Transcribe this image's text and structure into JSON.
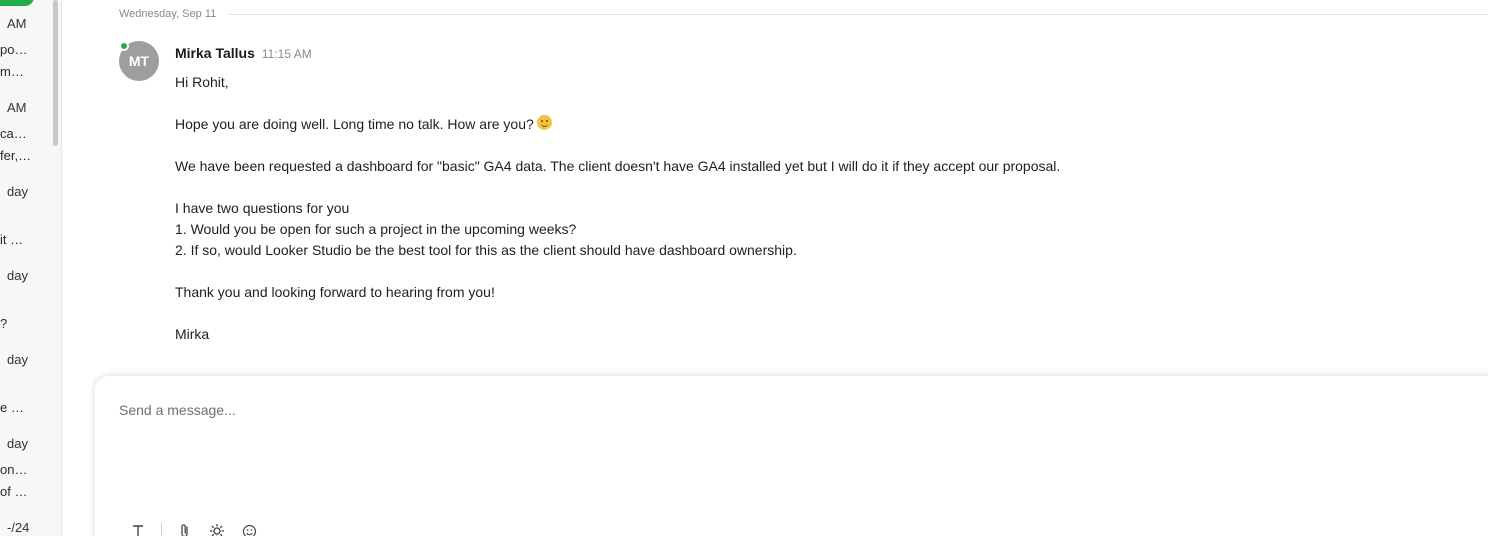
{
  "sidebar": {
    "items": [
      {
        "text": "AM"
      },
      {
        "text": "po…"
      },
      {
        "text": "m…"
      },
      {
        "text": "AM"
      },
      {
        "text": "ca…"
      },
      {
        "text": "fer,…"
      },
      {
        "text": "day"
      },
      {
        "text": "it …"
      },
      {
        "text": "day"
      },
      {
        "text": "?"
      },
      {
        "text": "day"
      },
      {
        "text": "e …"
      },
      {
        "text": "day"
      },
      {
        "text": "on…"
      },
      {
        "text": "of …"
      },
      {
        "text": "-/24"
      }
    ]
  },
  "date_separator": "Wednesday, Sep 11",
  "message": {
    "avatar_initials": "MT",
    "sender": "Mirka Tallus",
    "time": "11:15 AM",
    "lines": [
      "Hi Rohit,",
      "",
      "Hope you are doing well. Long time no talk. How are you?",
      "",
      "We have been requested a dashboard for \"basic\" GA4 data. The client doesn't have GA4 installed yet but I will do it if they accept our proposal.",
      "",
      "I have two questions for you",
      "1. Would you be open for such a project in the upcoming weeks?",
      "2. If so, would Looker Studio be the best tool for this as the client should have dashboard ownership.",
      "",
      "Thank you and looking forward to hearing from you!",
      "",
      "Mirka"
    ],
    "emoji_icon": "slightly-smiling-face"
  },
  "composer": {
    "placeholder": "Send a message...",
    "tools": [
      "text-format-icon",
      "attachment-icon",
      "settings-icon",
      "emoji-icon"
    ]
  },
  "colors": {
    "presence": "#1fae46",
    "avatar_bg": "#9e9e9e"
  }
}
